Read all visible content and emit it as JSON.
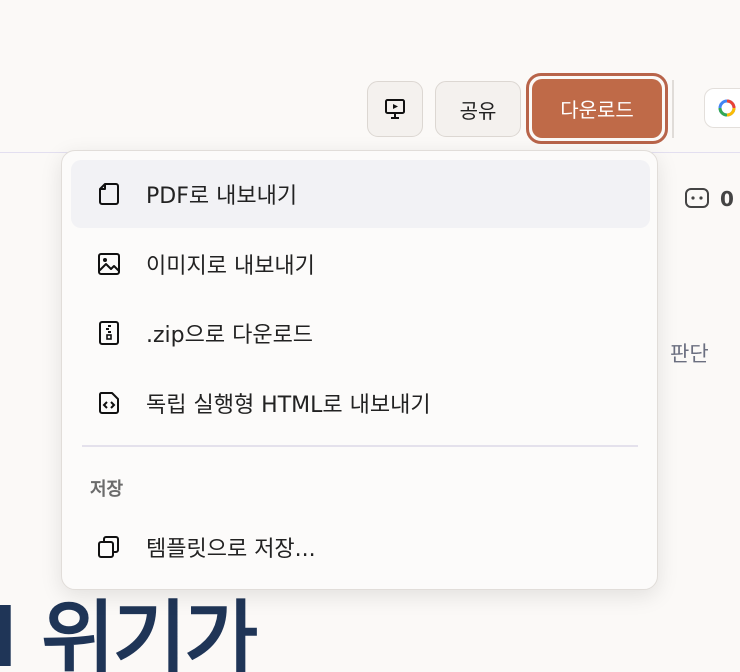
{
  "toolbar": {
    "present_icon": "presentation-screen-icon",
    "share_label": "공유",
    "download_label": "다운로드",
    "gemini_icon": "gemini-logo-icon"
  },
  "colors": {
    "download_bg": "#bf6a48",
    "download_ring": "#b8644a",
    "headline": "#1f3557",
    "side_text": "#6b6f80"
  },
  "comments": {
    "icon": "comment-bubble-icon",
    "count": "0"
  },
  "document": {
    "side_text": "판단",
    "headline": "l 위기가"
  },
  "download_menu": {
    "items": [
      {
        "label": "PDF로 내보내기",
        "icon": "pdf-file-icon",
        "highlighted": true
      },
      {
        "label": "이미지로 내보내기",
        "icon": "image-icon",
        "highlighted": false
      },
      {
        "label": ".zip으로 다운로드",
        "icon": "zip-archive-icon",
        "highlighted": false
      },
      {
        "label": "독립 실행형 HTML로 내보내기",
        "icon": "html-file-icon",
        "highlighted": false
      }
    ],
    "section_label": "저장",
    "save_items": [
      {
        "label": "템플릿으로 저장...",
        "icon": "copy-template-icon"
      }
    ]
  }
}
